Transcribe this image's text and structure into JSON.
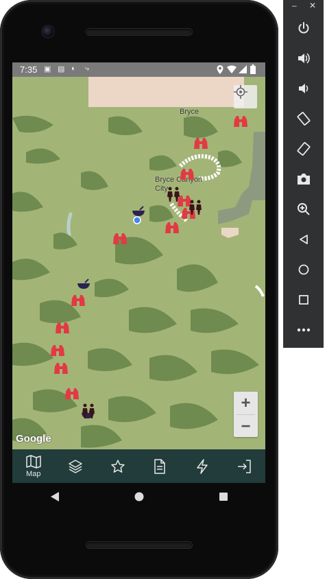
{
  "status_bar": {
    "time": "7:35",
    "icons": [
      "gallery-icon",
      "notification-icon",
      "data-saver-icon",
      "signal-wave-icon",
      "location-icon",
      "wifi-icon",
      "cell-signal-icon",
      "battery-icon"
    ]
  },
  "map": {
    "place_labels": [
      "Bryce",
      "Bryce Canyon City"
    ],
    "attribution": "Google",
    "controls": {
      "zoom_in": "+",
      "zoom_out": "−"
    },
    "markers": [
      {
        "type": "binoculars"
      },
      {
        "type": "binoculars"
      },
      {
        "type": "binoculars"
      },
      {
        "type": "binoculars"
      },
      {
        "type": "binoculars"
      },
      {
        "type": "binoculars"
      },
      {
        "type": "binoculars"
      },
      {
        "type": "binoculars"
      },
      {
        "type": "binoculars"
      },
      {
        "type": "binoculars"
      },
      {
        "type": "binoculars"
      },
      {
        "type": "binoculars"
      },
      {
        "type": "camp-bowl"
      },
      {
        "type": "camp-bowl"
      },
      {
        "type": "camp-bowl"
      },
      {
        "type": "hikers"
      },
      {
        "type": "hikers"
      },
      {
        "type": "hikers"
      },
      {
        "type": "user-location"
      }
    ]
  },
  "bottom_nav": {
    "items": [
      {
        "icon": "map-icon",
        "label": "Map",
        "active": true
      },
      {
        "icon": "layers-icon",
        "label": ""
      },
      {
        "icon": "star-icon",
        "label": ""
      },
      {
        "icon": "document-icon",
        "label": ""
      },
      {
        "icon": "lightning-icon",
        "label": ""
      },
      {
        "icon": "login-icon",
        "label": ""
      }
    ]
  },
  "system_nav": [
    "back-icon",
    "home-icon",
    "recents-icon"
  ],
  "emulator_panel": {
    "window_controls": [
      "minimize-icon",
      "close-icon"
    ],
    "buttons": [
      "power-icon",
      "volume-up-icon",
      "volume-down-icon",
      "rotate-left-icon",
      "rotate-right-icon",
      "screenshot-icon",
      "zoom-icon",
      "back-icon",
      "home-icon",
      "overview-icon",
      "more-icon"
    ]
  },
  "colors": {
    "map_green": "#9fb173",
    "forest_green": "#6e8a4e",
    "navbar": "#213c3a",
    "binoculars_red": "#e23a44",
    "status_bar": "#7a7a7a"
  }
}
